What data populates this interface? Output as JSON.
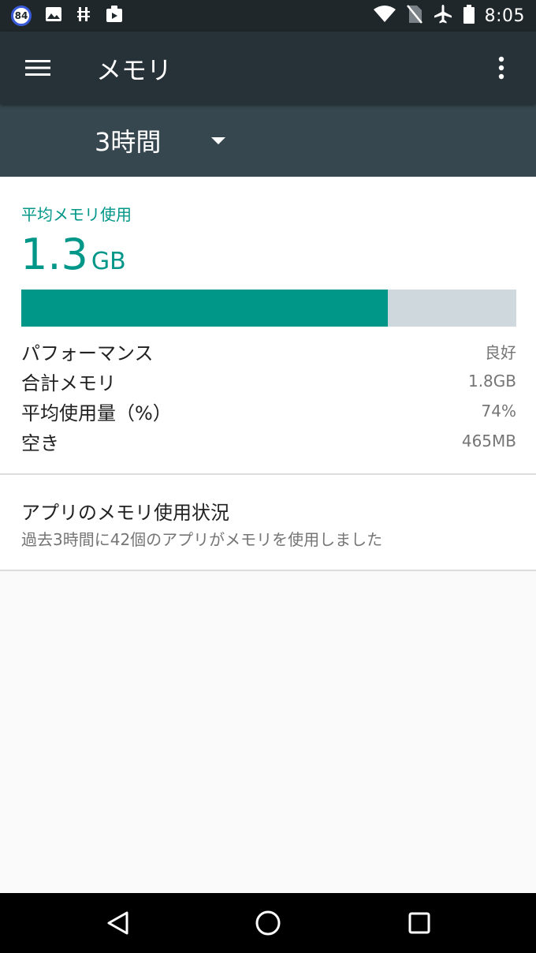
{
  "status_bar": {
    "notification_badge": "84",
    "time": "8:05",
    "left_icons": [
      "image-icon",
      "usb-debug-icon",
      "clipboard-play-icon"
    ],
    "right_icons": [
      "wifi-icon",
      "no-sim-icon",
      "airplane-icon",
      "battery-icon"
    ]
  },
  "app_bar": {
    "title": "メモリ"
  },
  "filter": {
    "selected": "3時間"
  },
  "summary": {
    "avg_label": "平均メモリ使用",
    "avg_number": "1.3",
    "avg_unit": "GB",
    "usage_fraction": 0.74,
    "colors": {
      "accent": "#009688",
      "bar_track": "#cfd8dc"
    },
    "stats": [
      {
        "label": "パフォーマンス",
        "value": "良好"
      },
      {
        "label": "合計メモリ",
        "value": "1.8GB"
      },
      {
        "label": "平均使用量（%）",
        "value": "74%"
      },
      {
        "label": "空き",
        "value": "465MB"
      }
    ]
  },
  "app_usage": {
    "title": "アプリのメモリ使用状況",
    "subtitle": "過去3時間に42個のアプリがメモリを使用しました"
  }
}
